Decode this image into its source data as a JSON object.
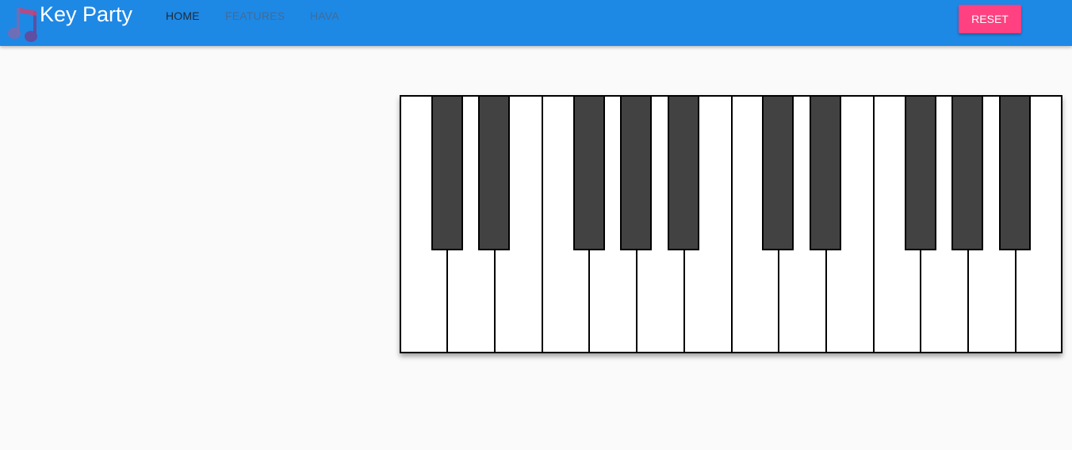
{
  "app": {
    "title": "Key Party",
    "logo_icon": "music-notes-icon"
  },
  "nav": {
    "items": [
      {
        "label": "HOME",
        "active": true
      },
      {
        "label": "FEATURES",
        "active": false
      },
      {
        "label": "HAVA",
        "active": false
      }
    ]
  },
  "toolbar": {
    "reset_label": "RESET"
  },
  "colors": {
    "header": "#1e88e5",
    "accent": "#ff4081",
    "black_key": "#424242",
    "background": "#fafafa"
  },
  "piano": {
    "white_key_count": 14,
    "black_key_count": 10
  }
}
